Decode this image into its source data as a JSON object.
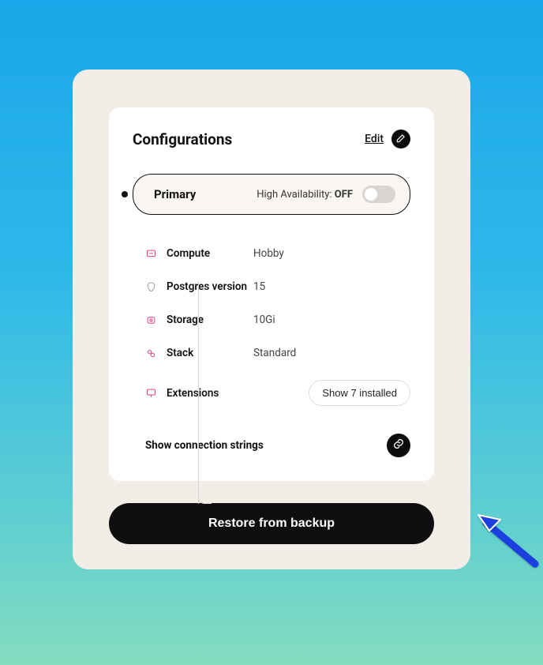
{
  "header": {
    "title": "Configurations",
    "edit_label": "Edit"
  },
  "primary": {
    "label": "Primary",
    "ha_prefix": "High Availability: ",
    "ha_status": "OFF"
  },
  "specs": {
    "compute": {
      "label": "Compute",
      "value": "Hobby"
    },
    "postgres": {
      "label": "Postgres version",
      "value": "15"
    },
    "storage": {
      "label": "Storage",
      "value": "10Gi"
    },
    "stack": {
      "label": "Stack",
      "value": "Standard"
    },
    "extensions": {
      "label": "Extensions",
      "button": "Show 7 installed"
    }
  },
  "connection": {
    "label": "Show connection strings"
  },
  "restore": {
    "label": "Restore from backup"
  }
}
